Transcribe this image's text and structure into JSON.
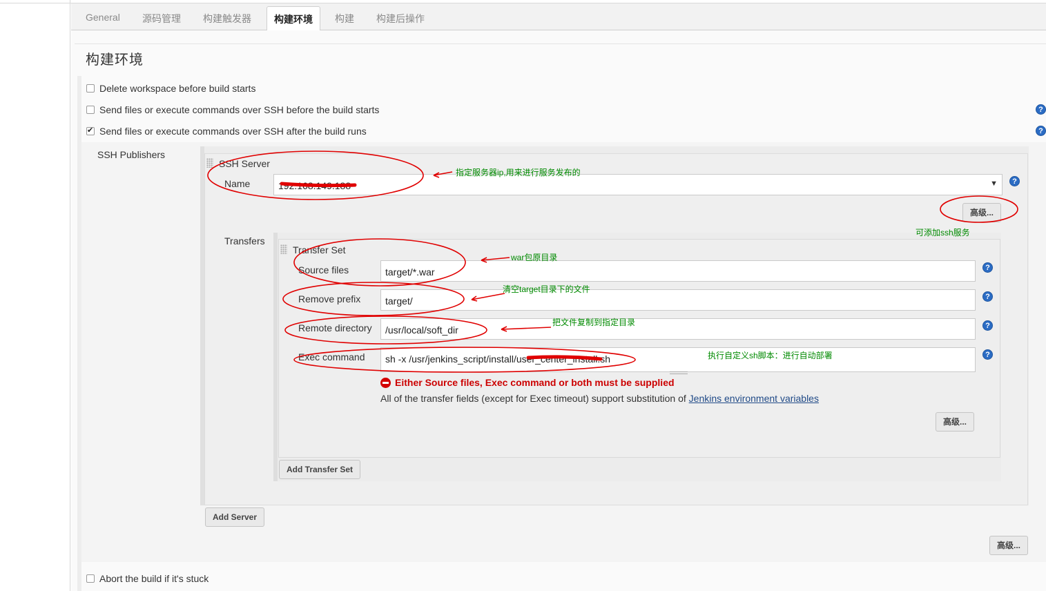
{
  "tabs": [
    {
      "label": "General"
    },
    {
      "label": "源码管理"
    },
    {
      "label": "构建触发器"
    },
    {
      "label": "构建环境"
    },
    {
      "label": "构建"
    },
    {
      "label": "构建后操作"
    }
  ],
  "active_tab": "构建环境",
  "section_title": "构建环境",
  "options": {
    "delete_workspace": {
      "label": "Delete workspace before build starts",
      "checked": false
    },
    "ssh_before": {
      "label": "Send files or execute commands over SSH before the build starts",
      "checked": false
    },
    "ssh_after": {
      "label": "Send files or execute commands over SSH after the build runs",
      "checked": true
    },
    "abort_stuck": {
      "label": "Abort the build if it's stuck",
      "checked": false
    }
  },
  "ssh_publishers": {
    "label": "SSH Publishers",
    "server_heading": "SSH Server",
    "name_label": "Name",
    "name_value": "192.168.149.188",
    "advanced_label": "高级...",
    "transfers_label": "Transfers",
    "transfer_set": {
      "heading": "Transfer Set",
      "source_files_label": "Source files",
      "source_files_value": "target/*.war",
      "remove_prefix_label": "Remove prefix",
      "remove_prefix_value": "target/",
      "remote_directory_label": "Remote directory",
      "remote_directory_value": "/usr/local/soft_dir",
      "exec_command_label": "Exec command",
      "exec_command_value": "sh -x /usr/jenkins_script/install/user_center_install.sh",
      "error": "Either Source files, Exec command or both must be supplied",
      "note": "All of the transfer fields (except for Exec timeout) support substitution of",
      "note_link": "Jenkins environment variables",
      "advanced_label": "高级..."
    },
    "add_transfer_set": "Add Transfer Set",
    "add_server": "Add Server",
    "outer_advanced_label": "高级..."
  },
  "help_glyph": "?",
  "annotations": {
    "server": "指定服务器ip,用来进行服务发布的",
    "ssh_service": "可添加ssh服务",
    "war": "war包原目录",
    "clear_target": "清空target目录下的文件",
    "copy_dir": "把文件复制到指定目录",
    "exec_script": "执行自定义sh脚本：进行自动部署"
  },
  "annotation_color": "#008a00",
  "markup_color": "#e00000"
}
